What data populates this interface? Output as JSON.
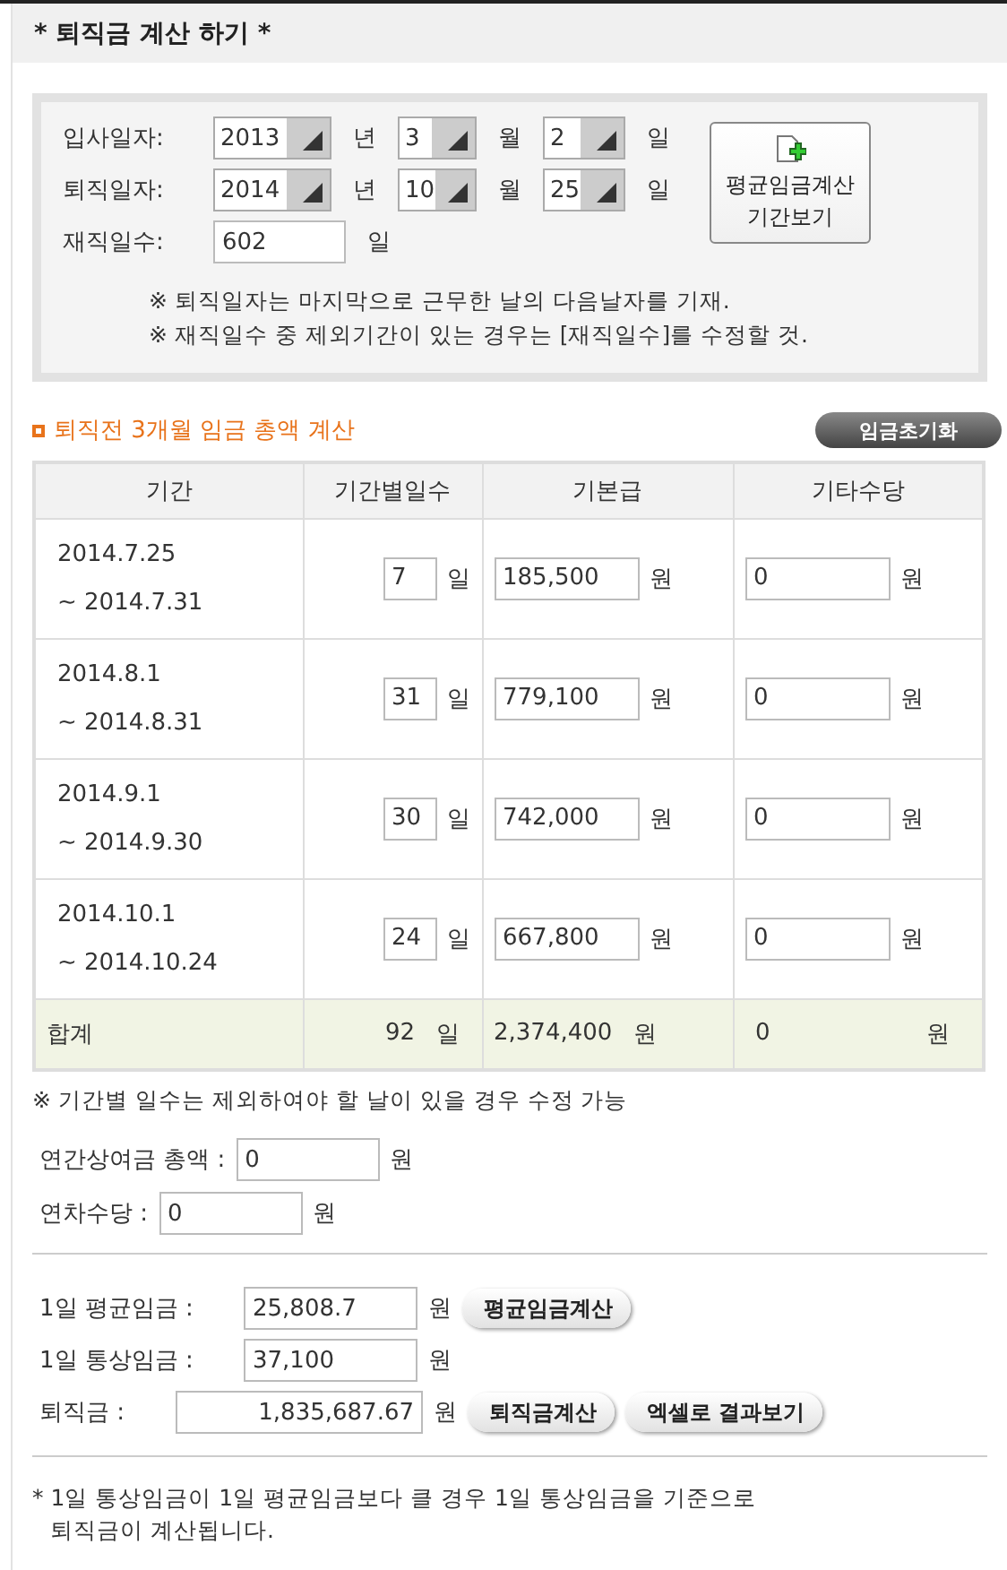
{
  "title": "* 퇴직금 계산 하기 *",
  "dates": {
    "rows": [
      {
        "label": "입사일자:",
        "year": "2013",
        "year_unit": "년",
        "month": "3",
        "month_unit": "월",
        "day": "2",
        "day_unit": "일"
      },
      {
        "label": "퇴직일자:",
        "year": "2014",
        "year_unit": "년",
        "month": "10",
        "month_unit": "월",
        "day": "25",
        "day_unit": "일"
      }
    ],
    "days": {
      "label": "재직일수:",
      "value": "602",
      "unit": "일"
    },
    "period_button": [
      "평균임금계산",
      "기간보기"
    ],
    "notes": [
      "※ 퇴직일자는 마지막으로 근무한 날의 다음날자를 기재.",
      "※ 재직일수 중 제외기간이 있는 경우는 [재직일수]를 수정할 것."
    ]
  },
  "wages": {
    "title": "퇴직전 3개월 임금 총액 계산",
    "reset_button": "임금초기화",
    "columns": [
      "기간",
      "기간별일수",
      "기본급",
      "기타수당"
    ],
    "rows": [
      {
        "start": "2014.7.25",
        "end": "~ 2014.7.31",
        "days": "7",
        "days_unit": "일",
        "base": "185,500",
        "base_unit": "원",
        "other": "0",
        "other_unit": "원"
      },
      {
        "start": "2014.8.1",
        "end": "~ 2014.8.31",
        "days": "31",
        "days_unit": "일",
        "base": "779,100",
        "base_unit": "원",
        "other": "0",
        "other_unit": "원"
      },
      {
        "start": "2014.9.1",
        "end": "~ 2014.9.30",
        "days": "30",
        "days_unit": "일",
        "base": "742,000",
        "base_unit": "원",
        "other": "0",
        "other_unit": "원"
      },
      {
        "start": "2014.10.1",
        "end": "~ 2014.10.24",
        "days": "24",
        "days_unit": "일",
        "base": "667,800",
        "base_unit": "원",
        "other": "0",
        "other_unit": "원"
      }
    ],
    "total": {
      "label": "합계",
      "days": "92",
      "days_unit": "일",
      "base": "2,374,400",
      "base_unit": "원",
      "other": "0",
      "other_unit": "원"
    },
    "note": "※ 기간별 일수는 제외하여야 할 날이 있을 경우 수정 가능"
  },
  "extras": [
    {
      "label": "연간상여금 총액 :",
      "value": "0",
      "unit": "원"
    },
    {
      "label": "연차수당 :",
      "value": "0",
      "unit": "원"
    }
  ],
  "results": [
    {
      "label": "1일 평균임금 :",
      "value": "25,808.7",
      "unit": "원",
      "buttons": [
        "평균임금계산"
      ]
    },
    {
      "label": "1일 통상임금 :",
      "value": "37,100",
      "unit": "원"
    },
    {
      "label": "퇴직금 :",
      "value": "1,835,687.67",
      "unit": "원",
      "buttons": [
        "퇴직금계산",
        "엑셀로 결과보기"
      ]
    }
  ],
  "footnote": "* 1일 통상임금이 1일 평균임금보다 클 경우 1일 통상임금을 기준으로 퇴직금이 계산됩니다."
}
